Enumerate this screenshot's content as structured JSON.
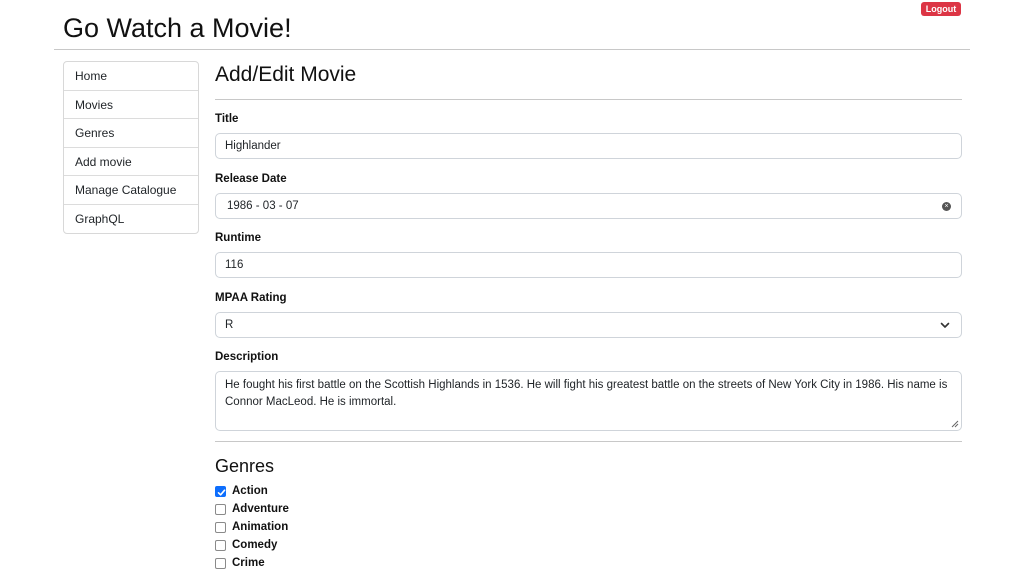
{
  "header": {
    "title": "Go Watch a Movie!",
    "logout_label": "Logout"
  },
  "sidebar": {
    "items": [
      {
        "label": "Home"
      },
      {
        "label": "Movies"
      },
      {
        "label": "Genres"
      },
      {
        "label": "Add movie"
      },
      {
        "label": "Manage Catalogue"
      },
      {
        "label": "GraphQL"
      }
    ]
  },
  "form": {
    "heading": "Add/Edit Movie",
    "title_label": "Title",
    "title_value": "Highlander",
    "release_label": "Release Date",
    "release_value": "1986 - 03 - 07",
    "runtime_label": "Runtime",
    "runtime_value": "116",
    "rating_label": "MPAA Rating",
    "rating_value": "R",
    "description_label": "Description",
    "description_value": "He fought his first battle on the Scottish Highlands in 1536. He will fight his greatest battle on the streets of New York City in 1986. His name is Connor MacLeod. He is immortal."
  },
  "genres": {
    "heading": "Genres",
    "items": [
      {
        "label": "Action",
        "checked": true
      },
      {
        "label": "Adventure",
        "checked": false
      },
      {
        "label": "Animation",
        "checked": false
      },
      {
        "label": "Comedy",
        "checked": false
      },
      {
        "label": "Crime",
        "checked": false
      }
    ]
  },
  "colors": {
    "logout": "#dc3545",
    "checkbox_checked": "#0d6efd"
  }
}
